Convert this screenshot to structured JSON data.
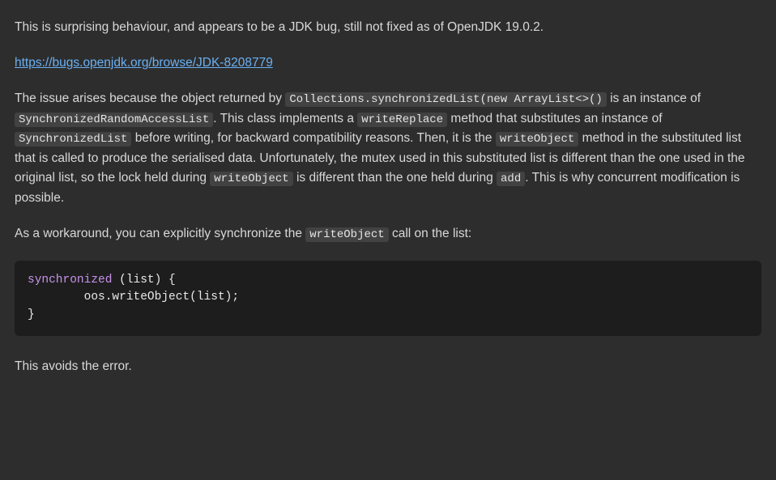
{
  "para1": "This is surprising behaviour, and appears to be a JDK bug, still not fixed as of OpenJDK 19.0.2.",
  "bug_link": {
    "href": "https://bugs.openjdk.org/browse/JDK-8208779",
    "text": "https://bugs.openjdk.org/browse/JDK-8208779"
  },
  "para3": {
    "t1": "The issue arises because the object returned by ",
    "c1": "Collections.synchronizedList(new ArrayList<>()",
    "t2": " is an instance of ",
    "c2": "SynchronizedRandomAccessList",
    "t3": ". This class implements a ",
    "c3": "writeReplace",
    "t4": " method that substitutes an instance of ",
    "c4": "SynchronizedList",
    "t5": " before writing, for backward compatibility reasons. Then, it is the ",
    "c5": "writeObject",
    "t6": " method in the substituted list that is called to produce the serialised data. Unfortunately, the mutex used in this substituted list is different than the one used in the original list, so the lock held during ",
    "c6": "writeObject",
    "t7": " is different than the one held during ",
    "c7": "add",
    "t8": ". This is why concurrent modification is possible."
  },
  "para4": {
    "t1": "As a workaround, you can explicitly synchronize the ",
    "c1": "writeObject",
    "t2": " call on the list:"
  },
  "codeblock": {
    "kw": "synchronized",
    "rest1": " (list) {",
    "line2": "        oos.writeObject(list);",
    "line3": "}"
  },
  "para5": "This avoids the error."
}
